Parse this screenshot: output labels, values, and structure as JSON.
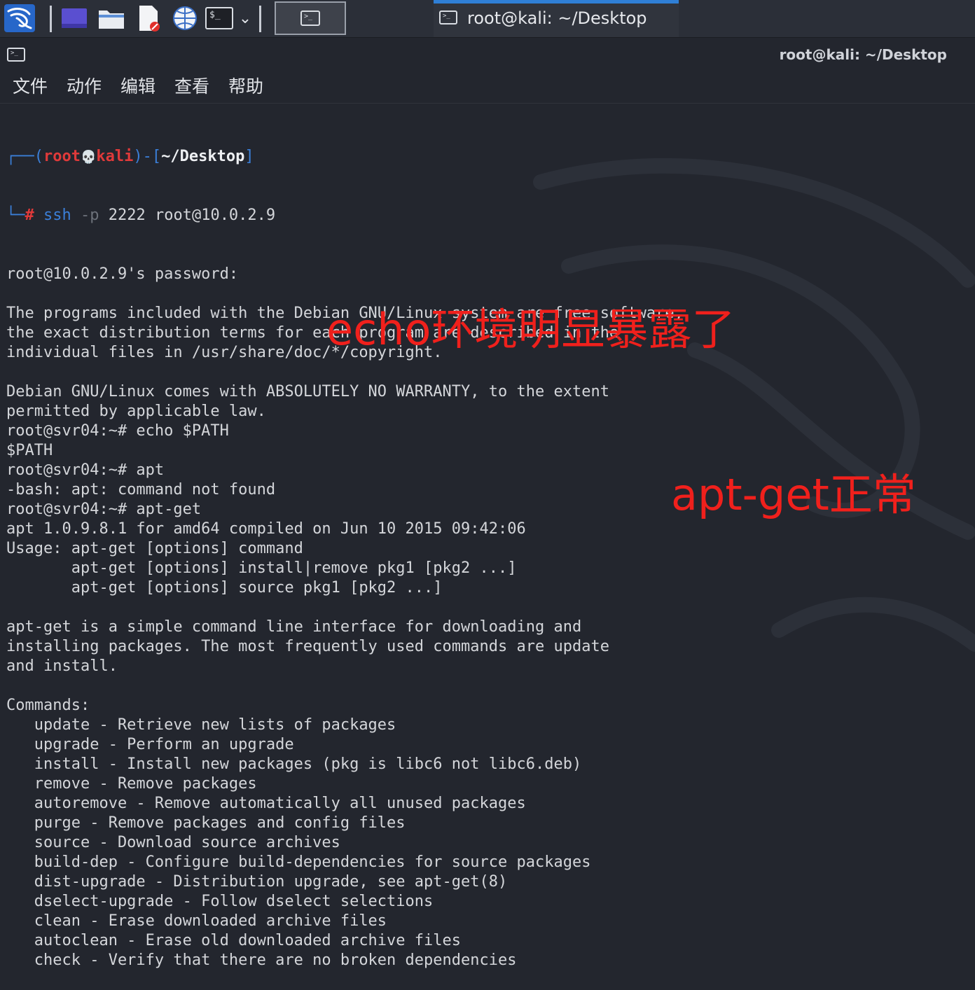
{
  "taskbar": {
    "task_label": "root@kali: ~/Desktop",
    "icons": [
      "kali-menu-icon",
      "workspace-icon",
      "file-manager-icon",
      "text-editor-icon",
      "browser-icon",
      "terminal-icon",
      "dropdown-icon",
      "active-terminal-icon"
    ]
  },
  "window": {
    "title": "root@kali: ~/Desktop"
  },
  "menu": {
    "file": "文件",
    "action": "动作",
    "edit": "编辑",
    "view": "查看",
    "help": "帮助"
  },
  "prompt": {
    "open": "┌──(",
    "user": "root",
    "skull": "💀",
    "host": "kali",
    "mid": ")-[",
    "dir": "~/Desktop",
    "close": "]",
    "corner": "└─",
    "hash": "#",
    "cmd": "ssh",
    "flag": "-p",
    "args": "2222 root@10.0.2.9"
  },
  "output_lines": [
    "root@10.0.2.9's password:",
    "",
    "The programs included with the Debian GNU/Linux system are free software;",
    "the exact distribution terms for each program are described in the",
    "individual files in /usr/share/doc/*/copyright.",
    "",
    "Debian GNU/Linux comes with ABSOLUTELY NO WARRANTY, to the extent",
    "permitted by applicable law.",
    "root@svr04:~# echo $PATH",
    "$PATH",
    "root@svr04:~# apt",
    "-bash: apt: command not found",
    "root@svr04:~# apt-get",
    "apt 1.0.9.8.1 for amd64 compiled on Jun 10 2015 09:42:06",
    "Usage: apt-get [options] command",
    "       apt-get [options] install|remove pkg1 [pkg2 ...]",
    "       apt-get [options] source pkg1 [pkg2 ...]",
    "",
    "apt-get is a simple command line interface for downloading and",
    "installing packages. The most frequently used commands are update",
    "and install.",
    "",
    "Commands:",
    "   update - Retrieve new lists of packages",
    "   upgrade - Perform an upgrade",
    "   install - Install new packages (pkg is libc6 not libc6.deb)",
    "   remove - Remove packages",
    "   autoremove - Remove automatically all unused packages",
    "   purge - Remove packages and config files",
    "   source - Download source archives",
    "   build-dep - Configure build-dependencies for source packages",
    "   dist-upgrade - Distribution upgrade, see apt-get(8)",
    "   dselect-upgrade - Follow dselect selections",
    "   clean - Erase downloaded archive files",
    "   autoclean - Erase old downloaded archive files",
    "   check - Verify that there are no broken dependencies"
  ],
  "annotations": {
    "echo_note": "echo环境明显暴露了",
    "aptget_note": "apt-get正常"
  },
  "colors": {
    "background": "#23262e",
    "prompt_blue": "#3b7fd8",
    "prompt_red": "#e03a3a",
    "annotation_red": "#f0201c",
    "accent": "#2f7fd6"
  }
}
